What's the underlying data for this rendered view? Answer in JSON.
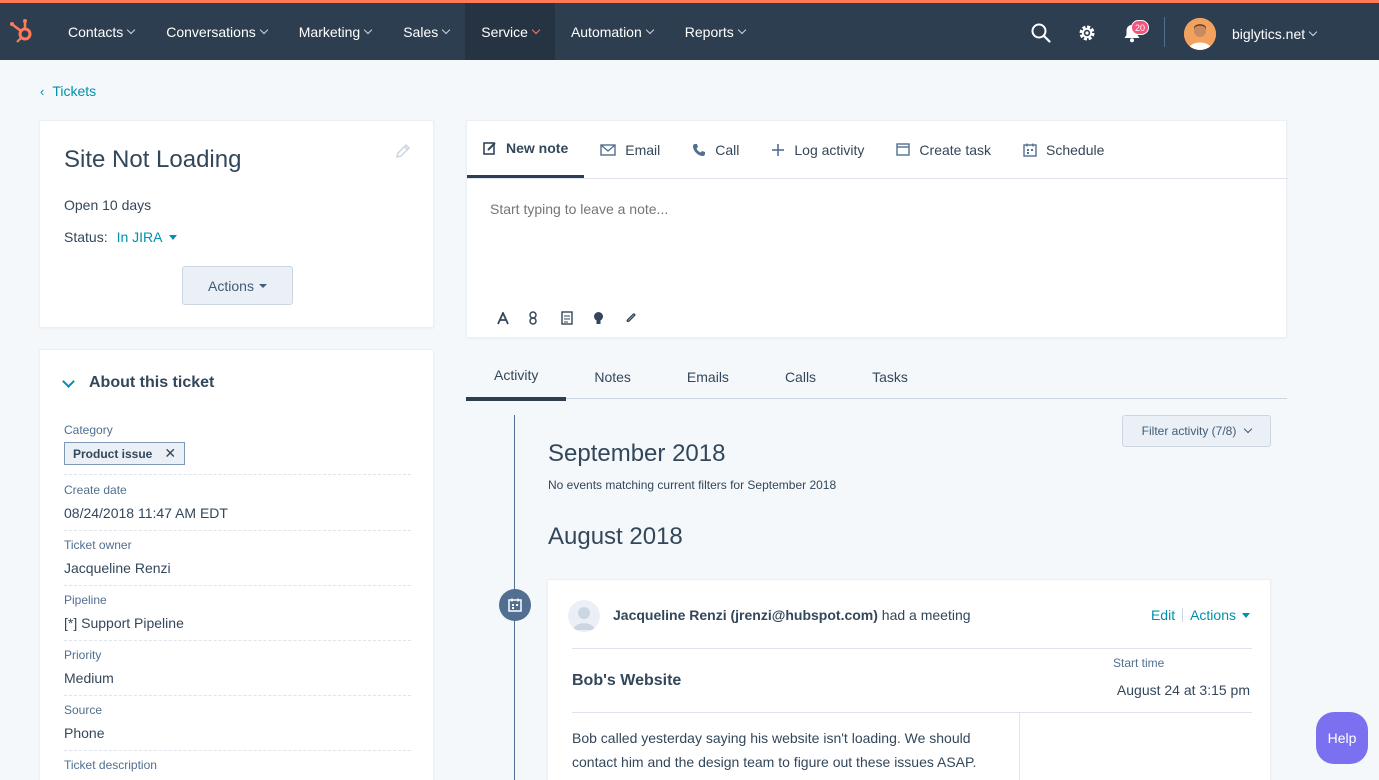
{
  "nav": {
    "items": [
      "Contacts",
      "Conversations",
      "Marketing",
      "Sales",
      "Service",
      "Automation",
      "Reports"
    ],
    "active": "Service",
    "notification_count": "20",
    "account": "biglytics.net"
  },
  "breadcrumb": {
    "back_label": "Tickets"
  },
  "ticket": {
    "title": "Site Not Loading",
    "open_for": "Open 10 days",
    "status_label": "Status:",
    "status_value": "In JIRA",
    "actions_label": "Actions"
  },
  "about": {
    "heading": "About this ticket",
    "category_label": "Category",
    "category_tag": "Product issue",
    "create_date_label": "Create date",
    "create_date": "08/24/2018 11:47 AM EDT",
    "owner_label": "Ticket owner",
    "owner": "Jacqueline Renzi",
    "pipeline_label": "Pipeline",
    "pipeline": "[*] Support Pipeline",
    "priority_label": "Priority",
    "priority": "Medium",
    "source_label": "Source",
    "source": "Phone",
    "description_label": "Ticket description"
  },
  "composer": {
    "tabs": [
      "New note",
      "Email",
      "Call",
      "Log activity",
      "Create task",
      "Schedule"
    ],
    "placeholder": "Start typing to leave a note..."
  },
  "activity": {
    "tabs": [
      "Activity",
      "Notes",
      "Emails",
      "Calls",
      "Tasks"
    ],
    "filter_label": "Filter activity (7/8)",
    "month1": "September 2018",
    "month1_empty": "No events matching current filters for September 2018",
    "month2": "August 2018",
    "event": {
      "actor": "Jacqueline Renzi (jrenzi@hubspot.com)",
      "verb": " had a meeting",
      "edit_label": "Edit",
      "actions_label": "Actions",
      "title": "Bob's Website",
      "start_label": "Start time",
      "start_value": "August 24 at 3:15 pm",
      "body": "Bob called yesterday saying his website isn't loading. We should contact him and the design team to figure out these issues ASAP."
    }
  },
  "help_label": "Help",
  "colors": {
    "nav_bg": "#2d3e50",
    "accent": "#ff7a59",
    "link": "#0091ae",
    "help": "#7b70f0"
  }
}
